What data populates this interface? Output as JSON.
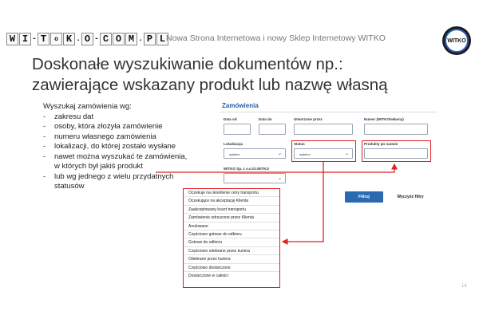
{
  "logo_left": {
    "letters": [
      "W",
      "I",
      "T",
      "K",
      "O",
      "C",
      "O",
      "M",
      "P",
      "L"
    ],
    "separators": [
      "-",
      ".",
      "-",
      "."
    ],
    "small": [
      "o"
    ]
  },
  "top_subtitle": "Nowa Strona Internetowa i nowy Sklep Internetowy WITKO",
  "logo_right": {
    "text": "WITKO"
  },
  "heading": {
    "line1": "Doskonałe wyszukiwanie dokumentów np.:",
    "line2": "zawierające wskazany produkt lub nazwę własną"
  },
  "left_list": {
    "intro": "Wyszukaj zamówienia wg:",
    "items": [
      "zakresu dat",
      "osoby, która złożyła zamówienie",
      "numeru własnego zamówienia",
      "lokalizacji, do której zostało wysłane",
      "nawet można wyszukać te zamówienia,",
      "w których był jakiś produkt",
      "lub wg jednego z wielu przydatnych",
      "statusów"
    ]
  },
  "orders_panel": {
    "title": "Zamówienia",
    "labels": {
      "date_from": "Data od",
      "date_to": "Data do",
      "created_by": "Utworzone przez",
      "number": "Numer (WITKO/własny)",
      "location": "Lokalizacja",
      "status": "Status",
      "product": "Produkty po nazwie",
      "company": "WITKO Sp. z o.o./G.WITKO"
    },
    "select_placeholder": "wybierz",
    "filter_button": "Filtruj",
    "clear_button": "Wyczyść filtry"
  },
  "status_options": [
    "Oczekuje na określenie ceny transportu",
    "Oczekujące na akceptację Klienta",
    "Zaakceptowany koszt transportu",
    "Zamówienie odrzucone przez Klienta",
    "Anulowane",
    "Częściowo gotowe do odbioru",
    "Gotowe do odbioru",
    "Częściowo odebrane przez kuriera",
    "Odebrane przez kuriera",
    "Częściowo dostarczone",
    "Dostarczone w całości"
  ],
  "page_number": "14",
  "colors": {
    "accent": "#1f5fa8",
    "highlight": "#dd2222"
  }
}
